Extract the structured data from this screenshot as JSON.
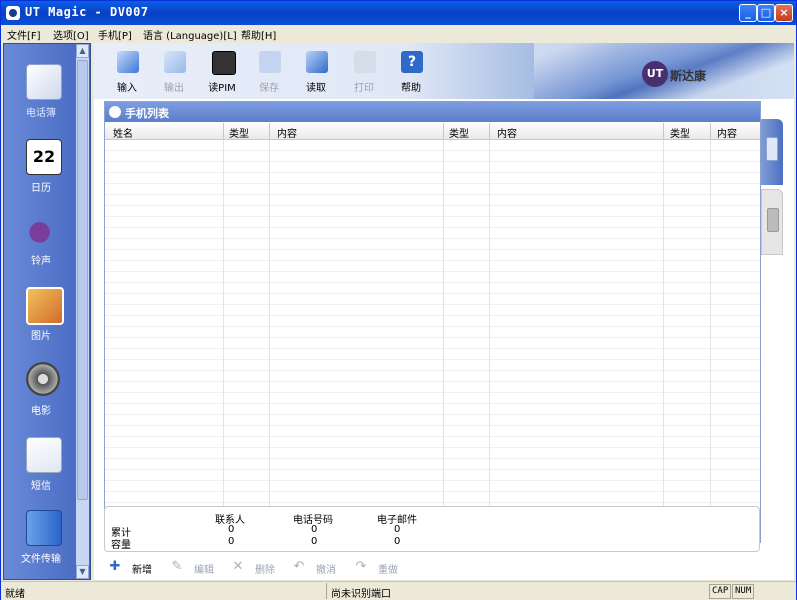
{
  "window": {
    "title": "UT Magic - DV007"
  },
  "titlebar_buttons": {
    "minimize": "_",
    "maximize": "□",
    "close": "×"
  },
  "menubar": [
    {
      "label": "文件[F]"
    },
    {
      "label": "选项[O]"
    },
    {
      "label": "手机[P]"
    },
    {
      "label": "语言 (Language)[L]"
    },
    {
      "label": "帮助[H]"
    }
  ],
  "sidebar": {
    "items": [
      {
        "label": "电话簿",
        "icon": "phonebook-icon",
        "active": true
      },
      {
        "label": "日历",
        "icon": "calendar-icon",
        "date": "22"
      },
      {
        "label": "铃声",
        "icon": "ringtone-icon"
      },
      {
        "label": "图片",
        "icon": "picture-icon"
      },
      {
        "label": "电影",
        "icon": "movie-icon"
      },
      {
        "label": "短信",
        "icon": "sms-icon"
      },
      {
        "label": "文件传输",
        "icon": "file-transfer-icon"
      }
    ]
  },
  "toolbar": {
    "items": [
      {
        "label": "输入",
        "icon": "import-icon",
        "enabled": true
      },
      {
        "label": "输出",
        "icon": "export-icon",
        "enabled": false
      },
      {
        "label": "读PIM",
        "icon": "read-pim-icon",
        "enabled": true
      },
      {
        "label": "保存",
        "icon": "save-icon",
        "enabled": false
      },
      {
        "label": "读取",
        "icon": "read-icon",
        "enabled": true
      },
      {
        "label": "打印",
        "icon": "print-icon",
        "enabled": false
      },
      {
        "label": "帮助",
        "icon": "help-icon",
        "enabled": true
      }
    ],
    "brand": {
      "mark": "UT",
      "name": "斯达康"
    }
  },
  "panel": {
    "title": "手机列表",
    "columns": [
      "姓名",
      "类型",
      "内容",
      "类型",
      "内容",
      "类型",
      "内容"
    ]
  },
  "summary": {
    "headers": [
      "联系人",
      "电话号码",
      "电子邮件"
    ],
    "rows": [
      {
        "label": "累计",
        "values": [
          "0",
          "0",
          "0"
        ]
      },
      {
        "label": "容量",
        "values": [
          "0",
          "0",
          "0"
        ]
      }
    ]
  },
  "actions": [
    {
      "label": "新增",
      "icon": "add-icon",
      "enabled": true
    },
    {
      "label": "编辑",
      "icon": "edit-icon",
      "enabled": false
    },
    {
      "label": "删除",
      "icon": "delete-icon",
      "enabled": false
    },
    {
      "label": "撤消",
      "icon": "undo-icon",
      "enabled": false
    },
    {
      "label": "重做",
      "icon": "redo-icon",
      "enabled": false
    }
  ],
  "statusbar": {
    "left": "就绪",
    "middle": "尚未识别端口",
    "cap": "CAP",
    "num": "NUM"
  },
  "colors": {
    "accent": "#0a4fd6",
    "sidebar": "#5577c8",
    "panel_header": "#6a8bd8"
  }
}
